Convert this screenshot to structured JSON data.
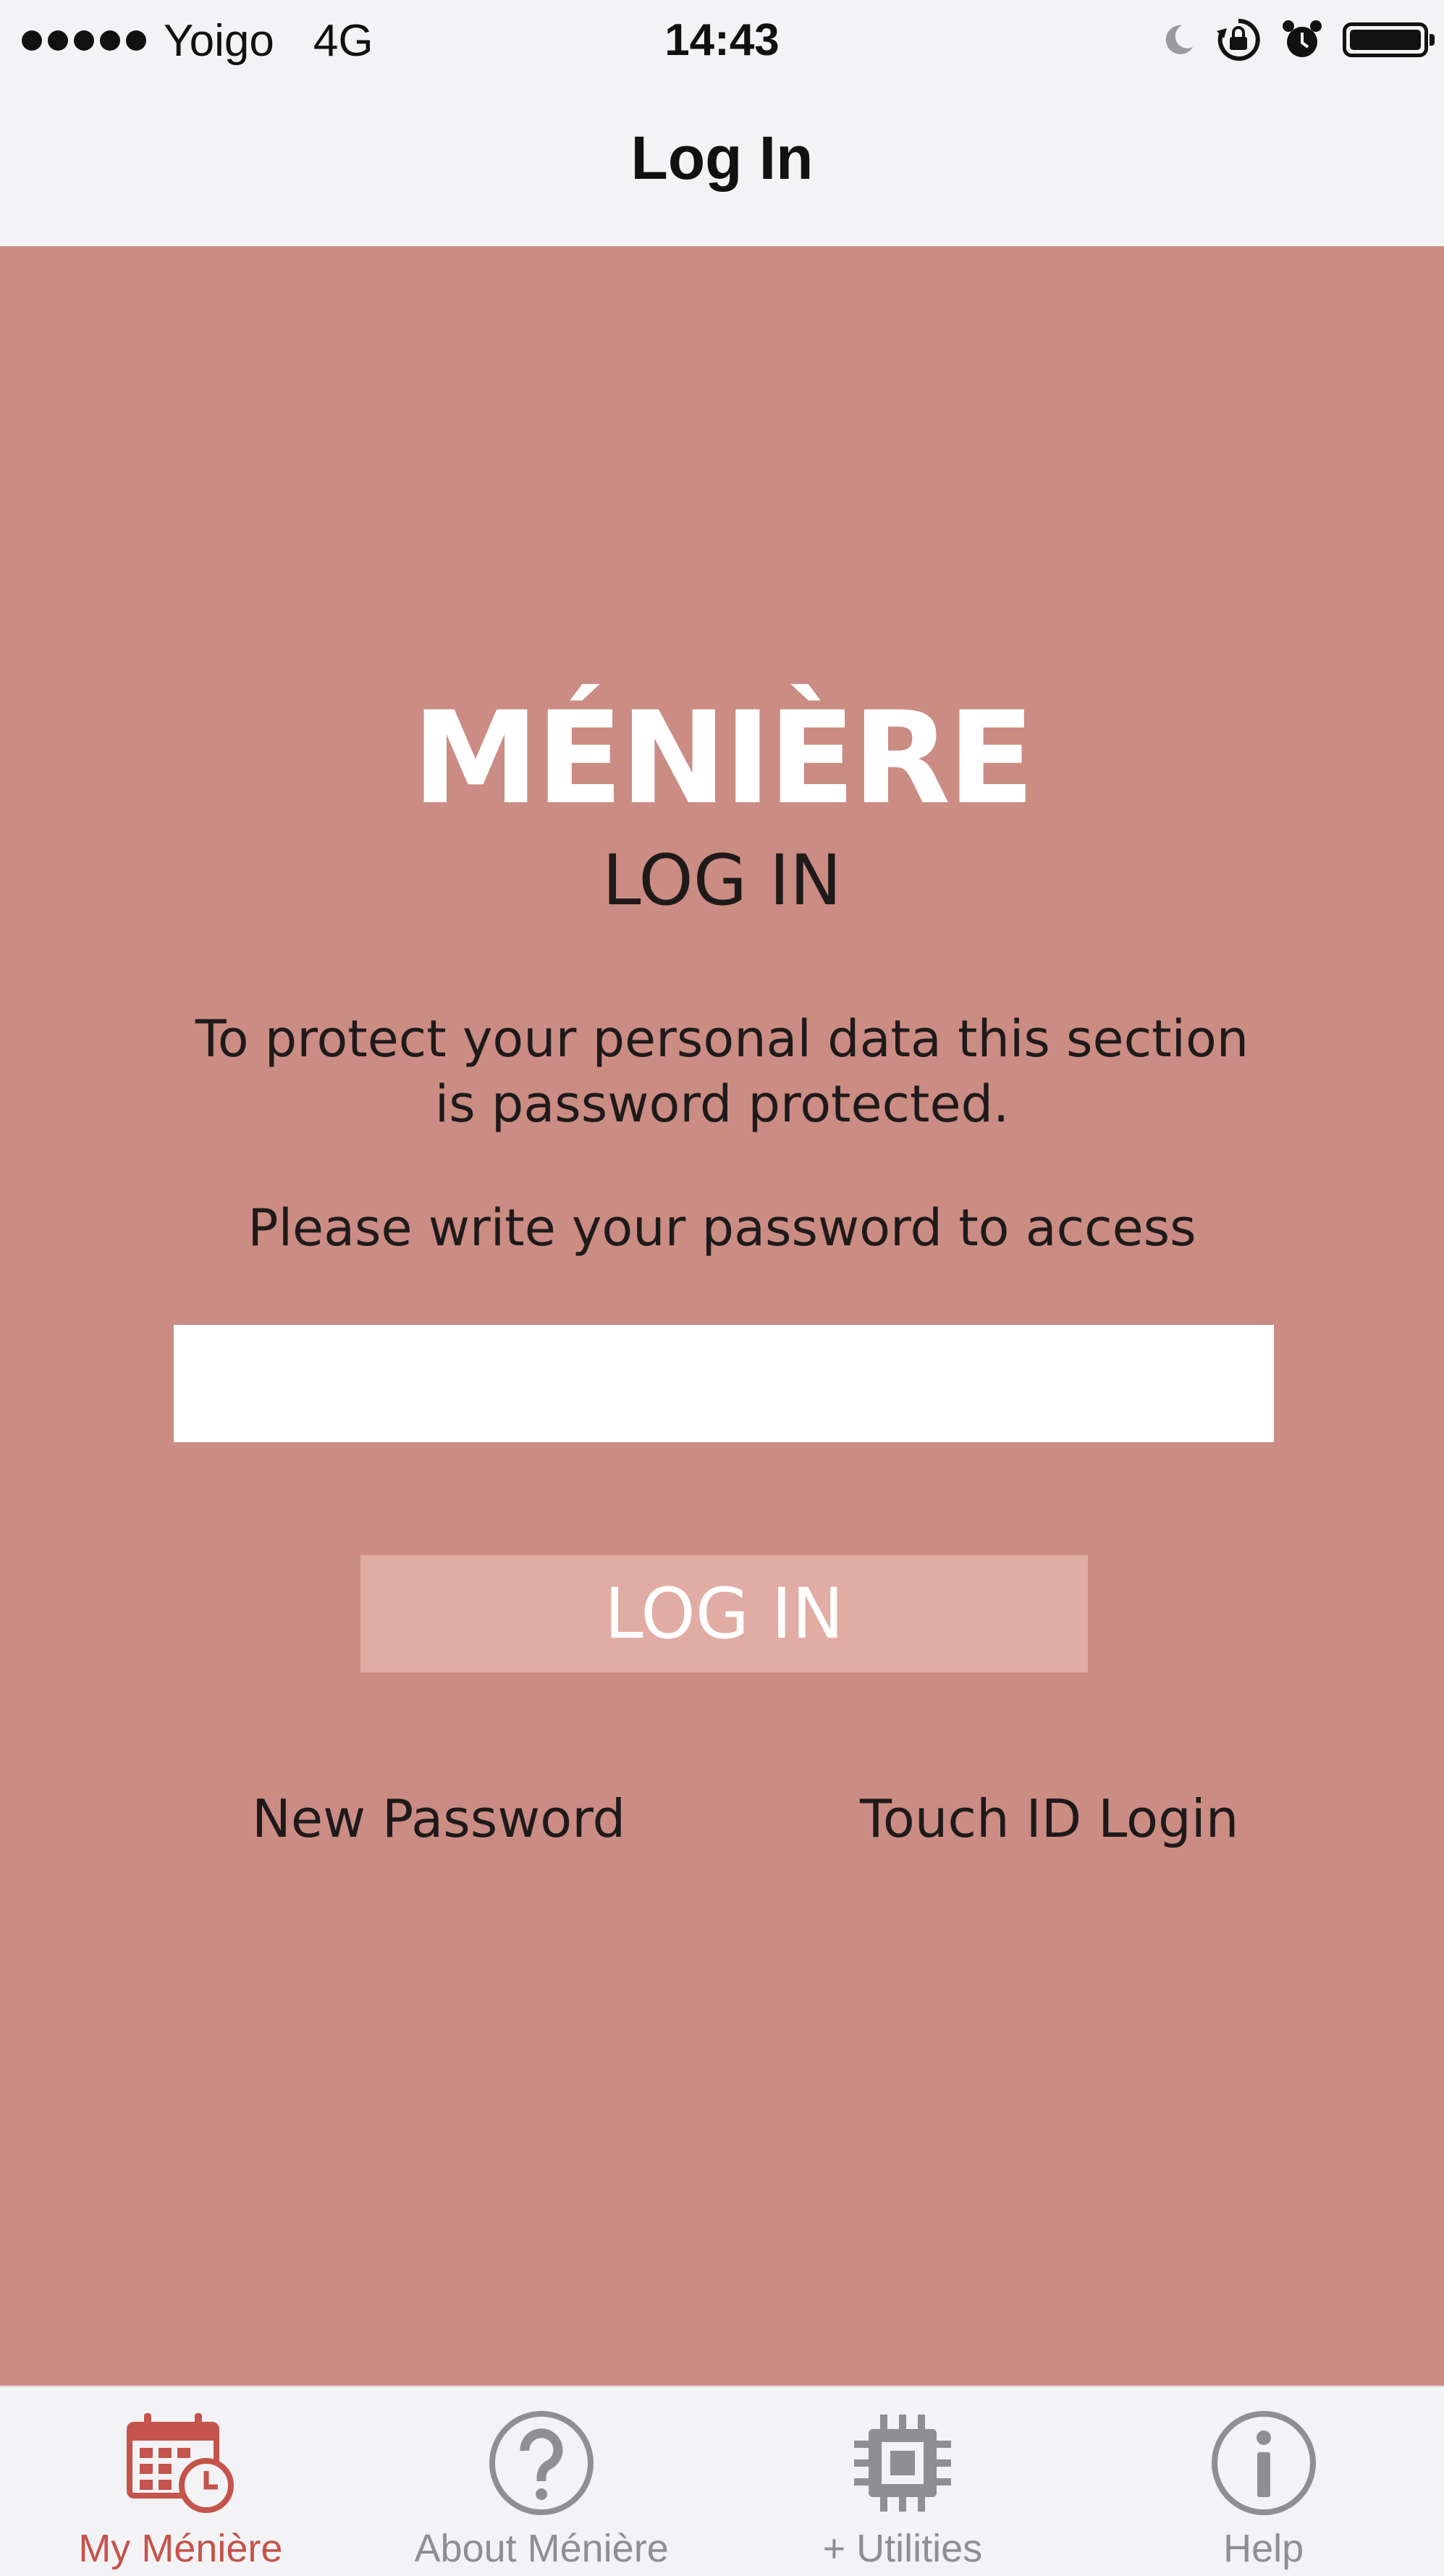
{
  "status_bar": {
    "carrier": "Yoigo",
    "network": "4G",
    "time": "14:43",
    "icons": [
      "moon-icon",
      "rotation-lock-icon",
      "alarm-icon",
      "battery-icon"
    ]
  },
  "nav": {
    "title": "Log In"
  },
  "main": {
    "logo": "MÉNIÈRE",
    "heading": "LOG IN",
    "description": "To protect your personal data this section is password protected.",
    "prompt": "Please write your password to access",
    "password": {
      "value": "",
      "placeholder": ""
    },
    "login_button": "LOG IN",
    "new_password_link": "New Password",
    "touch_id_link": "Touch ID Login"
  },
  "tabs": [
    {
      "label": "My Ménière",
      "icon": "calendar-clock-icon",
      "active": true
    },
    {
      "label": "About Ménière",
      "icon": "question-icon",
      "active": false
    },
    {
      "label": "+ Utilities",
      "icon": "chip-icon",
      "active": false
    },
    {
      "label": "Help",
      "icon": "info-icon",
      "active": false
    }
  ],
  "colors": {
    "background": "#cb8c84",
    "bars": "#f3f3f5",
    "button": "#e0aca4",
    "active_tab": "#c4544c",
    "inactive_tab": "#8e8e93"
  }
}
